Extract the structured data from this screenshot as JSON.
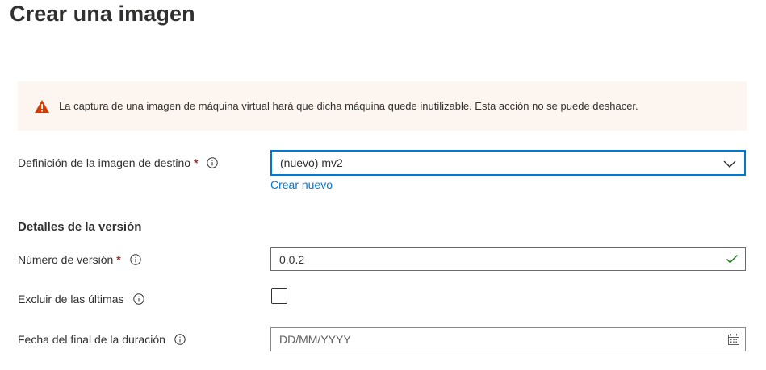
{
  "page": {
    "title": "Crear una imagen"
  },
  "warning": {
    "icon": "warning-icon",
    "color": "#d83b01",
    "text": "La captura de una imagen de máquina virtual hará que dicha máquina quede inutilizable. Esta acción no se puede deshacer."
  },
  "target_definition": {
    "label": "Definición de la imagen de destino",
    "required_mark": "*",
    "selected_value": "(nuevo) mv2",
    "create_new_link": "Crear nuevo"
  },
  "version_details": {
    "heading": "Detalles de la versión",
    "version_number": {
      "label": "Número de versión",
      "required_mark": "*",
      "value": "0.0.2",
      "valid": true
    },
    "exclude_from_latest": {
      "label": "Excluir de las últimas",
      "checked": false
    },
    "end_of_life_date": {
      "label": "Fecha del final de la duración",
      "placeholder": "DD/MM/YYYY"
    }
  },
  "colors": {
    "accent": "#0078d4",
    "required": "#a4262c",
    "valid": "#107c10",
    "warning_bg": "#fdf6f0"
  }
}
